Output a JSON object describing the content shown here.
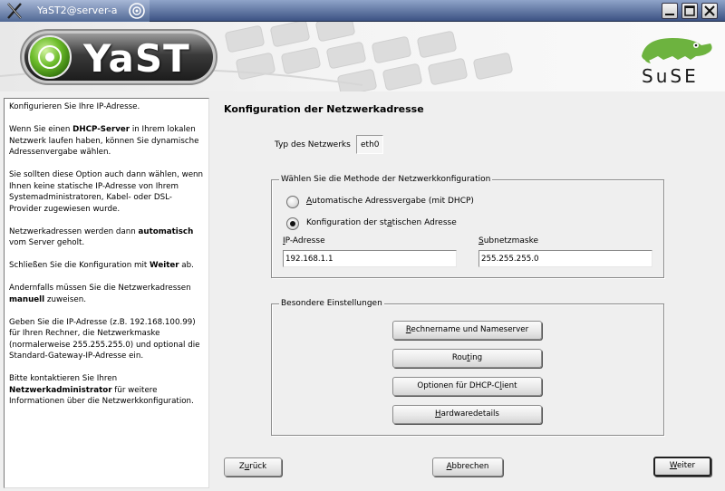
{
  "window": {
    "title": "YaST2@server-a"
  },
  "banner": {
    "yast_logo_text": "YaST",
    "suse_logo_text": "SuSE"
  },
  "help": {
    "p1": "Konfigurieren Sie Ihre IP-Adresse.",
    "p2_a": "Wenn Sie einen ",
    "p2_b": "DHCP-Server",
    "p2_c": " in Ihrem lokalen Netzwerk laufen haben, können Sie dynamische Adressenvergabe wählen.",
    "p3": "Sie sollten diese Option auch dann wählen, wenn Ihnen keine statische IP-Adresse von Ihrem Systemadministratoren, Kabel- oder DSL-Provider zugewiesen wurde.",
    "p4_a": "Netzwerkadressen werden dann ",
    "p4_b": "automatisch",
    "p4_c": " vom Server geholt.",
    "p5_a": "Schließen Sie die Konfiguration mit ",
    "p5_b": "Weiter",
    "p5_c": " ab.",
    "p6_a": "Andernfalls müssen Sie die Netzwerkadressen ",
    "p6_b": "manuell",
    "p6_c": " zuweisen.",
    "p7": "Geben Sie die IP-Adresse (z.B. 192.168.100.99) für Ihren Rechner, die Netzwerkmaske (normalerweise 255.255.255.0) und optional die Standard-Gateway-IP-Adresse ein.",
    "p8_a": "Bitte kontaktieren Sie Ihren ",
    "p8_b": "Netzwerkadministrator",
    "p8_c": " für weitere Informationen über die Netzwerkkonfiguration."
  },
  "main": {
    "title": "Konfiguration der Netzwerkadresse",
    "net_type_label": "Typ des Netzwerks",
    "net_type_value": "eth0",
    "method_group_title": "Wählen Sie die Methode der Netzwerkkonfiguration",
    "radio_dhcp": {
      "pre": "",
      "key": "A",
      "post": "utomatische Adressvergabe (mit DHCP)",
      "selected": false
    },
    "radio_static": {
      "pre": "Konfiguration der st",
      "key": "a",
      "post": "tischen Adresse",
      "selected": true
    },
    "ip_label": {
      "key": "I",
      "post": "P-Adresse"
    },
    "ip_value": "192.168.1.1",
    "subnet_label": {
      "key": "S",
      "post": "ubnetzmaske"
    },
    "subnet_value": "255.255.255.0",
    "special_group_title": "Besondere Einstellungen",
    "btn_hostname": {
      "key": "R",
      "post": "echnername und Nameserver"
    },
    "btn_routing": {
      "pre": "Rou",
      "key": "t",
      "post": "ing"
    },
    "btn_dhcp": {
      "pre": "Optionen für DHCP-C",
      "key": "l",
      "post": "ient"
    },
    "btn_hardware": {
      "key": "H",
      "post": "ardwaredetails"
    }
  },
  "footer": {
    "back": {
      "pre": "Z",
      "key": "u",
      "post": "rück"
    },
    "cancel": {
      "key": "A",
      "post": "bbrechen"
    },
    "next": {
      "key": "W",
      "post": "eiter"
    }
  },
  "colors": {
    "titlebar": "#3c5283",
    "background": "#efefef",
    "suse_green": "#6db33f",
    "yast_green": "#4e9a1f"
  }
}
